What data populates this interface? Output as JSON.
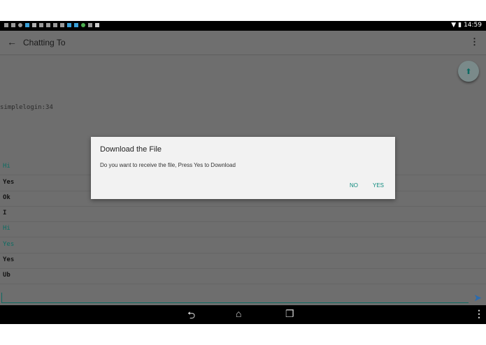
{
  "status_bar": {
    "time": "14:59"
  },
  "app_bar": {
    "title": "Chatting To"
  },
  "session_label": "simplelogin:34",
  "messages": [
    {
      "text": "Hi",
      "color": "#0e6b62"
    },
    {
      "text": "Yes",
      "color": "#141414"
    },
    {
      "text": "Ok",
      "color": "#141414"
    },
    {
      "text": "I",
      "color": "#141414"
    },
    {
      "text": "Hi",
      "color": "#0e6b62"
    },
    {
      "text": "Yes",
      "color": "#0e6b62"
    },
    {
      "text": "Yes",
      "color": "#141414"
    },
    {
      "text": "Ub",
      "color": "#141414"
    }
  ],
  "dialog": {
    "title": "Download the File",
    "message": "Do you want to receive the file, Press Yes to Download",
    "no_label": "NO",
    "yes_label": "YES"
  },
  "colors": {
    "accent": "#0e6b62",
    "dialog_button": "#0e8a7d",
    "send": "#2b6cb0"
  },
  "icons": [
    "back-arrow-icon",
    "overflow-menu-icon",
    "upload-icon",
    "send-icon",
    "nav-back-icon",
    "nav-home-icon",
    "nav-recents-icon",
    "wifi-icon",
    "battery-icon"
  ]
}
